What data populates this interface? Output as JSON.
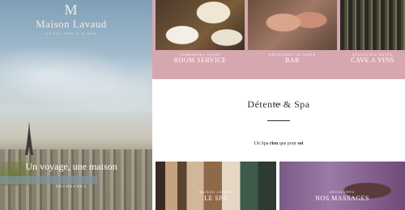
{
  "hero": {
    "logo_mark": "M",
    "logo_name": "Maison Lavaud",
    "logo_tagline": "HÔTEL PARIS & SPA",
    "title": "Un voyage, une maison",
    "cta": "DÉCOUVREZ"
  },
  "band": {
    "color": "#d7a7b0",
    "cards": [
      {
        "kicker": "COMMANDEZ VOTRE",
        "title": "ROOM SERVICE"
      },
      {
        "kicker": "DÉCOUVREZ LA CARTE",
        "title": "BAR"
      },
      {
        "kicker": "DÉCOUVREZ NOTRE",
        "title": "CAVE A VINS"
      }
    ]
  },
  "spa_section": {
    "title": "Détente & Spa",
    "tagline_prefix": "Un Spa ",
    "tagline_bold1": "rien",
    "tagline_mid": " que pour ",
    "tagline_bold2": "soi",
    "cards": [
      {
        "kicker": "MAISON LAVAUD",
        "title": "LE SPA"
      },
      {
        "kicker": "DÉCOUVREZ",
        "title": "NOS MASSAGES"
      }
    ]
  }
}
